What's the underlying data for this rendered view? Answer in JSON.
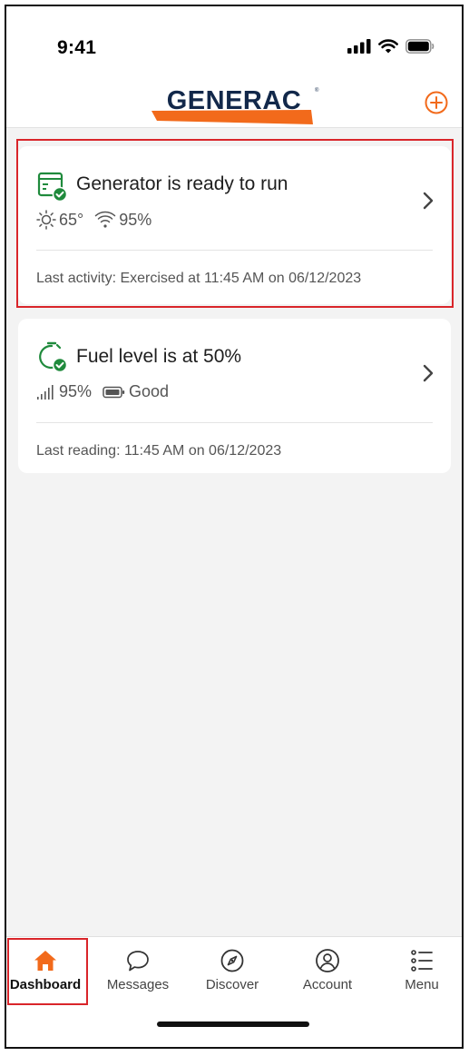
{
  "status_bar": {
    "time": "9:41"
  },
  "header": {
    "brand": "GENERAC",
    "add_icon": "plus-circle-icon"
  },
  "colors": {
    "accent": "#f26a1b",
    "brand_navy": "#12284a",
    "success": "#1f8a3c",
    "highlight": "#d9252a"
  },
  "cards": [
    {
      "title": "Generator is ready to run",
      "icon": "generator-check-icon",
      "temperature": "65°",
      "wifi": "95%",
      "footer": "Last activity: Exercised at 11:45 AM on 06/12/2023"
    },
    {
      "title": "Fuel level is at 50%",
      "icon": "fuel-tank-check-icon",
      "signal": "95%",
      "battery": "Good",
      "footer": "Last reading: 11:45 AM on 06/12/2023"
    }
  ],
  "tabs": [
    {
      "label": "Dashboard",
      "icon": "home-icon",
      "active": true
    },
    {
      "label": "Messages",
      "icon": "chat-bubble-icon"
    },
    {
      "label": "Discover",
      "icon": "compass-icon"
    },
    {
      "label": "Account",
      "icon": "user-circle-icon"
    },
    {
      "label": "Menu",
      "icon": "list-menu-icon"
    }
  ]
}
